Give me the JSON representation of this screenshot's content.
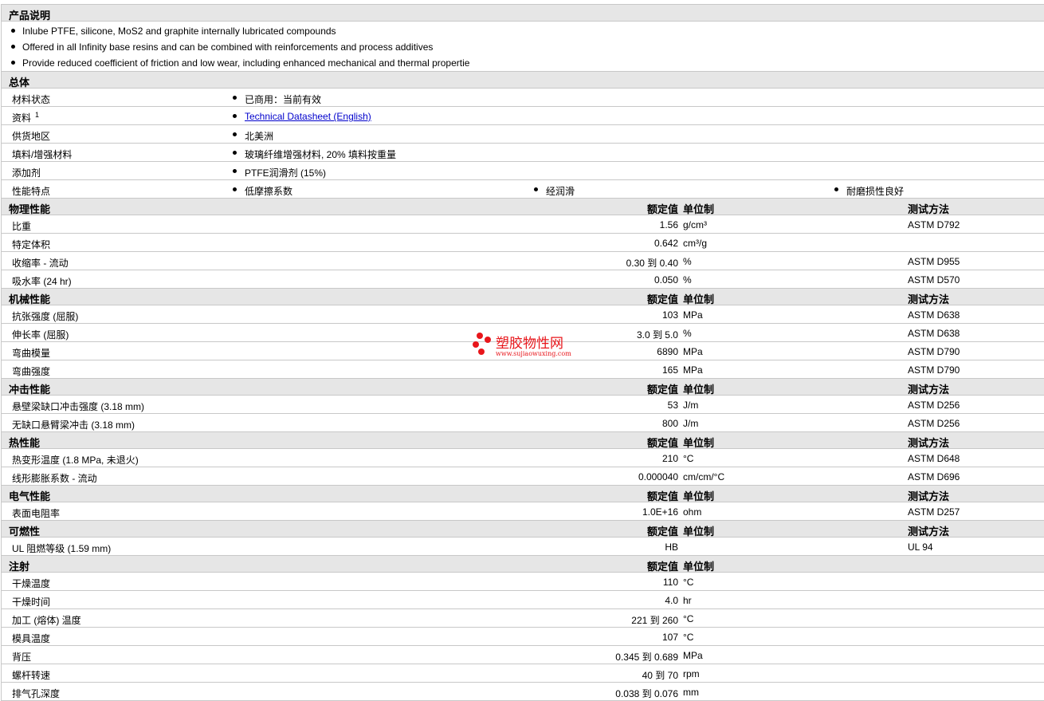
{
  "description": {
    "title": "产品说明",
    "bullets": [
      "Inlube PTFE, silicone, MoS2 and graphite internally lubricated compounds",
      "Offered in all Infinity base resins and can be combined with reinforcements and process additives",
      "Provide reduced coefficient of friction and low wear, including enhanced mechanical and thermal propertie"
    ]
  },
  "general": {
    "title": "总体",
    "rows": [
      {
        "label": "材料状态",
        "value": "已商用：当前有效"
      },
      {
        "label": "资料",
        "sup": "1",
        "value": "Technical Datasheet (English)",
        "link": true
      },
      {
        "label": "供货地区",
        "value": "北美洲"
      },
      {
        "label": "填料/增强材料",
        "value": "玻璃纤维增强材料, 20% 填料按重量"
      },
      {
        "label": "添加剂",
        "value": "PTFE润滑剂 (15%)"
      },
      {
        "label": "性能特点",
        "value": "低摩擦系数",
        "value2": "经润滑",
        "value3": "耐磨损性良好"
      }
    ]
  },
  "headers": {
    "nominal": "额定值",
    "unit": "单位制",
    "test": "测试方法"
  },
  "sections": [
    {
      "title": "物理性能",
      "show_headers": true,
      "rows": [
        {
          "label": "比重",
          "value": "1.56",
          "unit": "g/cm³",
          "test": "ASTM D792"
        },
        {
          "label": "特定体积",
          "value": "0.642",
          "unit": "cm³/g",
          "test": ""
        },
        {
          "label": "收缩率 - 流动",
          "value": "0.30 到  0.40",
          "unit": "%",
          "test": "ASTM D955"
        },
        {
          "label": "吸水率 (24 hr)",
          "value": "0.050",
          "unit": "%",
          "test": "ASTM D570"
        }
      ]
    },
    {
      "title": "机械性能",
      "show_headers": true,
      "rows": [
        {
          "label": "抗张强度 (屈服)",
          "value": "103",
          "unit": "MPa",
          "test": "ASTM D638"
        },
        {
          "label": "伸长率 (屈服)",
          "value": "3.0 到  5.0",
          "unit": "%",
          "test": "ASTM D638"
        },
        {
          "label": "弯曲模量",
          "value": "6890",
          "unit": "MPa",
          "test": "ASTM D790"
        },
        {
          "label": "弯曲强度",
          "value": "165",
          "unit": "MPa",
          "test": "ASTM D790"
        }
      ]
    },
    {
      "title": "冲击性能",
      "show_headers": true,
      "rows": [
        {
          "label": "悬壁梁缺口冲击强度 (3.18 mm)",
          "value": "53",
          "unit": "J/m",
          "test": "ASTM D256"
        },
        {
          "label": "无缺口悬臂梁冲击 (3.18 mm)",
          "value": "800",
          "unit": "J/m",
          "test": "ASTM D256"
        }
      ]
    },
    {
      "title": "热性能",
      "show_headers": true,
      "rows": [
        {
          "label": "热变形温度 (1.8 MPa, 未退火)",
          "value": "210",
          "unit": "°C",
          "test": "ASTM D648"
        },
        {
          "label": "线形膨胀系数 - 流动",
          "value": "0.000040",
          "unit": "cm/cm/°C",
          "test": "ASTM D696"
        }
      ]
    },
    {
      "title": "电气性能",
      "show_headers": true,
      "rows": [
        {
          "label": "表面电阻率",
          "value": "1.0E+16",
          "unit": "ohm",
          "test": "ASTM D257"
        }
      ]
    },
    {
      "title": "可燃性",
      "show_headers": true,
      "rows": [
        {
          "label": "UL 阻燃等级 (1.59 mm)",
          "value": "HB",
          "unit": "",
          "test": "UL 94"
        }
      ]
    },
    {
      "title": "注射",
      "show_headers": false,
      "rows": [
        {
          "label": "干燥温度",
          "value": "110",
          "unit": "°C",
          "test": ""
        },
        {
          "label": "干燥时间",
          "value": "4.0",
          "unit": "hr",
          "test": ""
        },
        {
          "label": "加工 (熔体) 温度",
          "value": "221 到  260",
          "unit": "°C",
          "test": ""
        },
        {
          "label": "模具温度",
          "value": "107",
          "unit": "°C",
          "test": ""
        },
        {
          "label": "背压",
          "value": "0.345 到  0.689",
          "unit": "MPa",
          "test": ""
        },
        {
          "label": "螺杆转速",
          "value": "40 到  70",
          "unit": "rpm",
          "test": ""
        },
        {
          "label": "排气孔深度",
          "value": "0.038 到  0.076",
          "unit": "mm",
          "test": ""
        }
      ]
    }
  ],
  "watermark": {
    "name": "塑胶物性网",
    "url": "www.sujiaowuxing.com",
    "color": "#e8161b"
  }
}
